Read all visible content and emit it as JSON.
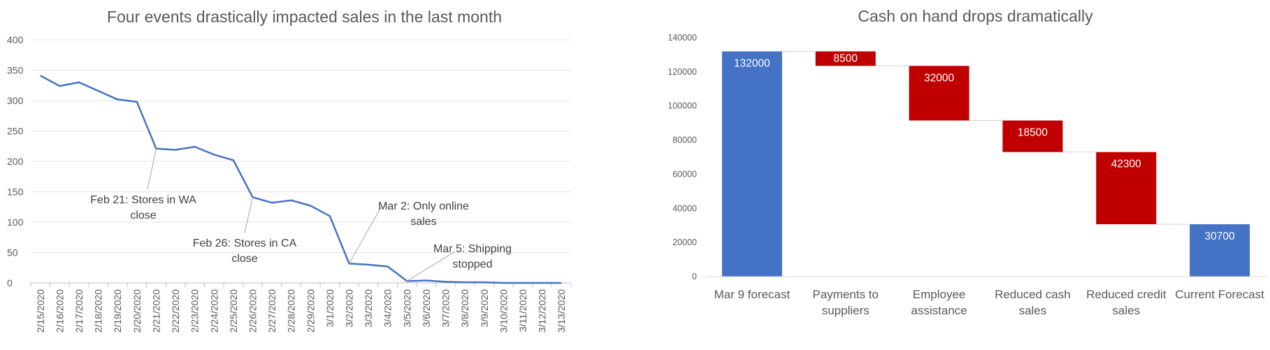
{
  "chart_data": [
    {
      "type": "line",
      "title": "Four events drastically impacted sales in the last month",
      "xlabel": "",
      "ylabel": "",
      "ylim": [
        0,
        400
      ],
      "yticks": [
        0,
        50,
        100,
        150,
        200,
        250,
        300,
        350,
        400
      ],
      "grid": true,
      "x": [
        "2/15/2020",
        "2/16/2020",
        "2/17/2020",
        "2/18/2020",
        "2/19/2020",
        "2/20/2020",
        "2/21/2020",
        "2/22/2020",
        "2/23/2020",
        "2/24/2020",
        "2/25/2020",
        "2/26/2020",
        "2/27/2020",
        "2/28/2020",
        "2/29/2020",
        "3/1/2020",
        "3/2/2020",
        "3/3/2020",
        "3/4/2020",
        "3/5/2020",
        "3/6/2020",
        "3/7/2020",
        "3/8/2020",
        "3/9/2020",
        "3/10/2020",
        "3/11/2020",
        "3/12/2020",
        "3/13/2020"
      ],
      "series": [
        {
          "color": "#4472C4",
          "values": [
            341,
            324,
            330,
            316,
            302,
            298,
            221,
            219,
            224,
            211,
            202,
            141,
            132,
            136,
            127,
            110,
            32,
            30,
            27,
            3,
            4,
            2,
            1,
            1,
            0,
            0,
            0,
            0
          ]
        }
      ],
      "annotations": [
        {
          "lines": [
            "Feb 21: Stores in WA",
            "close"
          ],
          "x": "2/21/2020",
          "y": 221
        },
        {
          "lines": [
            "Feb 26: Stores in CA",
            "close"
          ],
          "x": "2/26/2020",
          "y": 141
        },
        {
          "lines": [
            "Mar 2: Only online",
            "sales"
          ],
          "x": "3/2/2020",
          "y": 32
        },
        {
          "lines": [
            "Mar 5: Shipping",
            "stopped"
          ],
          "x": "3/5/2020",
          "y": 3
        }
      ]
    },
    {
      "type": "bar",
      "subtype": "waterfall",
      "title": "Cash on hand drops dramatically",
      "xlabel": "",
      "ylabel": "",
      "ylim": [
        0,
        140000
      ],
      "yticks": [
        0,
        20000,
        40000,
        60000,
        80000,
        100000,
        120000,
        140000
      ],
      "grid": false,
      "categories": [
        [
          "Mar 9 forecast"
        ],
        [
          "Payments to",
          "suppliers"
        ],
        [
          "Employee",
          "assistance"
        ],
        [
          "Reduced cash",
          "sales"
        ],
        [
          "Reduced credit",
          "sales"
        ],
        [
          "Current Forecast"
        ]
      ],
      "values": [
        132000,
        -8500,
        -32000,
        -18500,
        -42300,
        30700
      ],
      "labels": [
        "132000",
        "8500",
        "32000",
        "18500",
        "42300",
        "30700"
      ],
      "kinds": [
        "total",
        "decrease",
        "decrease",
        "decrease",
        "decrease",
        "total"
      ],
      "colors": {
        "total": "#4472C4",
        "decrease": "#C00000"
      }
    }
  ]
}
